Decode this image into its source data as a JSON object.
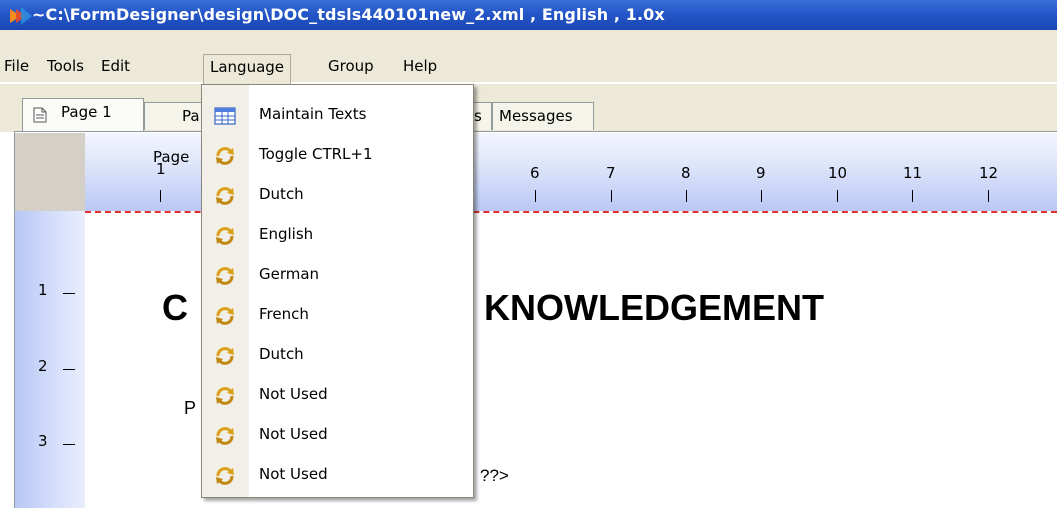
{
  "window": {
    "title": "~C:\\FormDesigner\\design\\DOC_tdsls440101new_2.xml , English , 1.0x"
  },
  "menubar": {
    "items": [
      "File",
      "Tools",
      "Edit",
      "Language",
      "Group",
      "Help"
    ]
  },
  "tabs": {
    "page1": "Page 1",
    "page2_partial": "Pa",
    "hidden_partial": "s",
    "messages": "Messages"
  },
  "ruler": {
    "page_label": "Page",
    "top_numbers": [
      "1",
      "6",
      "7",
      "8",
      "9",
      "10",
      "11",
      "12"
    ],
    "left_numbers": [
      "1",
      "2",
      "3"
    ]
  },
  "document": {
    "heading_left": "C",
    "heading_right": "KNOWLEDGEMENT",
    "para_letter": "P",
    "placeholder_fragment": "??>"
  },
  "language_menu": {
    "items": [
      {
        "label": "Maintain Texts",
        "icon": "table-icon"
      },
      {
        "label": "Toggle CTRL+1",
        "icon": "switch-icon"
      },
      {
        "label": "Dutch",
        "icon": "switch-icon"
      },
      {
        "label": "English",
        "icon": "switch-icon"
      },
      {
        "label": "German",
        "icon": "switch-icon"
      },
      {
        "label": "French",
        "icon": "switch-icon"
      },
      {
        "label": "Dutch",
        "icon": "switch-icon"
      },
      {
        "label": "Not Used",
        "icon": "switch-icon"
      },
      {
        "label": "Not Used",
        "icon": "switch-icon"
      },
      {
        "label": "Not Used",
        "icon": "switch-icon"
      }
    ]
  },
  "colors": {
    "titlebar": "#2456c8",
    "chrome": "#ece9d8",
    "ruler_blue": "#b9c8f4",
    "margin_line": "#e03030"
  }
}
